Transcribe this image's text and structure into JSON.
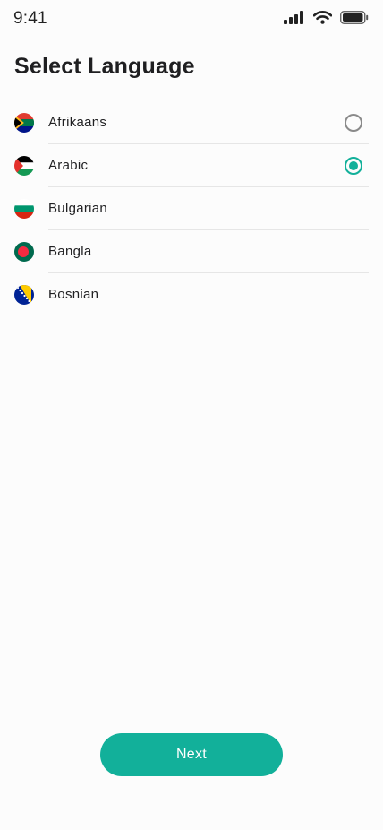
{
  "status_bar": {
    "time": "9:41"
  },
  "page": {
    "title": "Select Language"
  },
  "languages": [
    {
      "label": "Afrikaans",
      "flag_icon": "south-africa-flag-icon",
      "has_radio": true,
      "selected": false
    },
    {
      "label": "Arabic",
      "flag_icon": "palestine-flag-icon",
      "has_radio": true,
      "selected": true
    },
    {
      "label": "Bulgarian",
      "flag_icon": "bulgaria-flag-icon",
      "has_radio": false,
      "selected": false
    },
    {
      "label": "Bangla",
      "flag_icon": "bangladesh-flag-icon",
      "has_radio": false,
      "selected": false
    },
    {
      "label": "Bosnian",
      "flag_icon": "bosnia-flag-icon",
      "has_radio": false,
      "selected": false
    }
  ],
  "footer": {
    "next_label": "Next"
  },
  "colors": {
    "accent": "#12b09a",
    "text": "#1f1f21",
    "divider": "#e6e6e6",
    "background": "#fcfcfc"
  }
}
